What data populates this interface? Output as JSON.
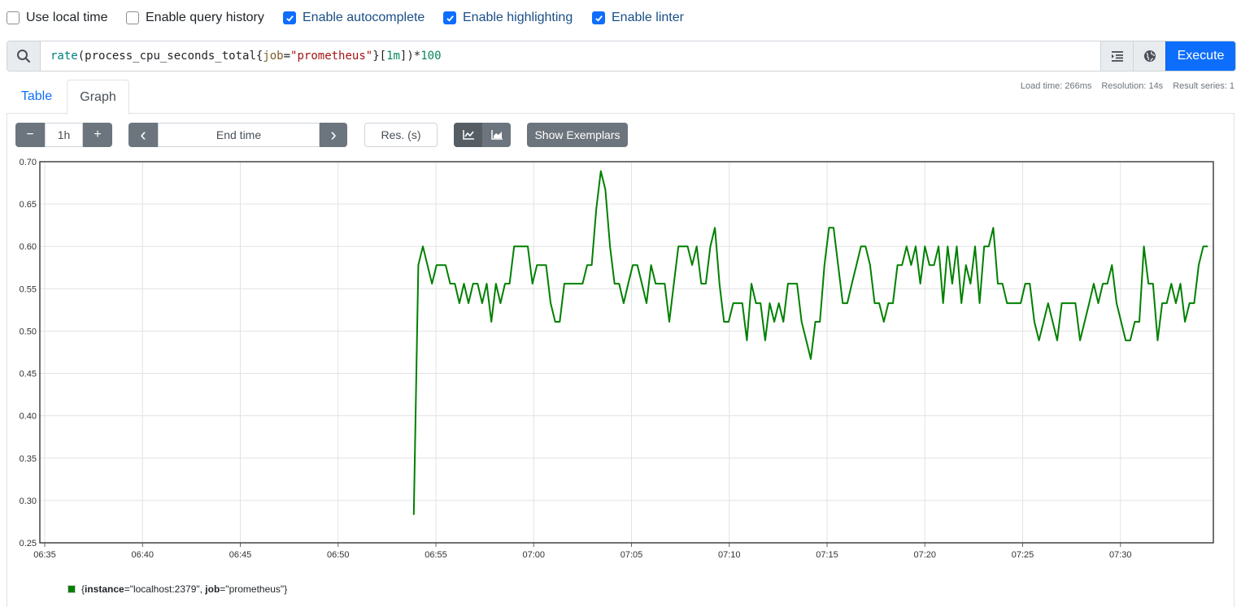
{
  "options": [
    {
      "label": "Use local time",
      "checked": false
    },
    {
      "label": "Enable query history",
      "checked": false
    },
    {
      "label": "Enable autocomplete",
      "checked": true
    },
    {
      "label": "Enable highlighting",
      "checked": true
    },
    {
      "label": "Enable linter",
      "checked": true
    }
  ],
  "query": {
    "fn": "rate",
    "metric": "process_cpu_seconds_total",
    "label_name": "job",
    "label_value": "\"prometheus\"",
    "range": "1m",
    "multiplier": "100"
  },
  "execute_label": "Execute",
  "stats": {
    "load_time": "Load time: 266ms",
    "resolution": "Resolution: 14s",
    "result_series": "Result series: 1"
  },
  "tabs": {
    "table": "Table",
    "graph": "Graph"
  },
  "controls": {
    "range_value": "1h",
    "minus": "−",
    "plus": "+",
    "end_time_placeholder": "End time",
    "prev": "‹",
    "next": "›",
    "res_placeholder": "Res. (s)",
    "show_exemplars": "Show Exemplars"
  },
  "icons": {
    "search": "search-icon",
    "format": "format-expression-icon",
    "metrics_explorer": "globe-icon",
    "line_mode": "line-chart-icon",
    "stacked_mode": "area-chart-icon"
  },
  "colors": {
    "accent": "#0d6efd",
    "series": "#008000"
  },
  "legend": {
    "open": "{",
    "k1": "instance",
    "v1": "=\"localhost:2379\", ",
    "k2": "job",
    "v2": "=\"prometheus\"",
    "close": "}"
  },
  "chart_data": {
    "type": "line",
    "x_ticks": [
      "06:35",
      "06:40",
      "06:45",
      "06:50",
      "06:55",
      "07:00",
      "07:05",
      "07:10",
      "07:15",
      "07:20",
      "07:25",
      "07:30"
    ],
    "y_ticks": [
      "0.25",
      "0.30",
      "0.35",
      "0.40",
      "0.45",
      "0.50",
      "0.55",
      "0.60",
      "0.65",
      "0.70"
    ],
    "xlim": [
      "06:34:45",
      "07:34:45"
    ],
    "ylim": [
      0.25,
      0.7
    ],
    "grid": true,
    "series": [
      {
        "name": "{instance=\"localhost:2379\", job=\"prometheus\"}",
        "x": [
          "06:53:52",
          "06:54:06",
          "06:54:20",
          "06:54:34",
          "06:54:48",
          "06:55:02",
          "06:55:16",
          "06:55:30",
          "06:55:44",
          "06:55:58",
          "06:56:12",
          "06:56:26",
          "06:56:40",
          "06:56:54",
          "06:57:08",
          "06:57:22",
          "06:57:36",
          "06:57:50",
          "06:58:04",
          "06:58:18",
          "06:58:32",
          "06:58:46",
          "06:59:00",
          "06:59:14",
          "06:59:28",
          "06:59:42",
          "06:59:56",
          "07:00:10",
          "07:00:24",
          "07:00:38",
          "07:00:52",
          "07:01:06",
          "07:01:20",
          "07:01:34",
          "07:01:48",
          "07:02:02",
          "07:02:16",
          "07:02:30",
          "07:02:44",
          "07:02:58",
          "07:03:12",
          "07:03:26",
          "07:03:40",
          "07:03:54",
          "07:04:08",
          "07:04:22",
          "07:04:36",
          "07:04:50",
          "07:05:04",
          "07:05:18",
          "07:05:32",
          "07:05:46",
          "07:06:00",
          "07:06:14",
          "07:06:28",
          "07:06:42",
          "07:06:56",
          "07:07:10",
          "07:07:24",
          "07:07:38",
          "07:07:52",
          "07:08:06",
          "07:08:20",
          "07:08:34",
          "07:08:48",
          "07:09:02",
          "07:09:16",
          "07:09:30",
          "07:09:44",
          "07:09:58",
          "07:10:12",
          "07:10:26",
          "07:10:40",
          "07:10:54",
          "07:11:08",
          "07:11:22",
          "07:11:36",
          "07:11:50",
          "07:12:04",
          "07:12:18",
          "07:12:32",
          "07:12:46",
          "07:13:00",
          "07:13:14",
          "07:13:28",
          "07:13:42",
          "07:13:56",
          "07:14:10",
          "07:14:24",
          "07:14:38",
          "07:14:52",
          "07:15:06",
          "07:15:20",
          "07:15:34",
          "07:15:48",
          "07:16:02",
          "07:16:16",
          "07:16:30",
          "07:16:44",
          "07:16:58",
          "07:17:12",
          "07:17:26",
          "07:17:40",
          "07:17:54",
          "07:18:08",
          "07:18:22",
          "07:18:36",
          "07:18:50",
          "07:19:04",
          "07:19:18",
          "07:19:32",
          "07:19:46",
          "07:20:00",
          "07:20:14",
          "07:20:28",
          "07:20:42",
          "07:20:56",
          "07:21:10",
          "07:21:24",
          "07:21:38",
          "07:21:52",
          "07:22:06",
          "07:22:20",
          "07:22:34",
          "07:22:48",
          "07:23:02",
          "07:23:16",
          "07:23:30",
          "07:23:44",
          "07:23:58",
          "07:24:12",
          "07:24:26",
          "07:24:40",
          "07:24:54",
          "07:25:08",
          "07:25:22",
          "07:25:36",
          "07:25:50",
          "07:26:04",
          "07:26:18",
          "07:26:32",
          "07:26:46",
          "07:27:00",
          "07:27:14",
          "07:27:28",
          "07:27:42",
          "07:27:56",
          "07:28:10",
          "07:28:24",
          "07:28:38",
          "07:28:52",
          "07:29:06",
          "07:29:20",
          "07:29:34",
          "07:29:48",
          "07:30:02",
          "07:30:16",
          "07:30:30",
          "07:30:44",
          "07:30:58",
          "07:31:12",
          "07:31:26",
          "07:31:40",
          "07:31:54",
          "07:32:08",
          "07:32:22",
          "07:32:36",
          "07:32:50",
          "07:33:04",
          "07:33:18",
          "07:33:32",
          "07:33:46",
          "07:34:00",
          "07:34:14",
          "07:34:28"
        ],
        "values": [
          0.283,
          0.578,
          0.6,
          0.578,
          0.556,
          0.578,
          0.578,
          0.578,
          0.556,
          0.556,
          0.533,
          0.556,
          0.533,
          0.556,
          0.556,
          0.533,
          0.556,
          0.511,
          0.556,
          0.533,
          0.556,
          0.556,
          0.6,
          0.6,
          0.6,
          0.6,
          0.556,
          0.578,
          0.578,
          0.578,
          0.533,
          0.511,
          0.511,
          0.556,
          0.556,
          0.556,
          0.556,
          0.556,
          0.578,
          0.578,
          0.644,
          0.689,
          0.667,
          0.6,
          0.556,
          0.556,
          0.533,
          0.556,
          0.578,
          0.578,
          0.556,
          0.533,
          0.578,
          0.556,
          0.556,
          0.556,
          0.511,
          0.556,
          0.6,
          0.6,
          0.6,
          0.578,
          0.6,
          0.556,
          0.556,
          0.6,
          0.622,
          0.556,
          0.511,
          0.511,
          0.533,
          0.533,
          0.533,
          0.489,
          0.556,
          0.533,
          0.533,
          0.489,
          0.533,
          0.511,
          0.533,
          0.511,
          0.556,
          0.556,
          0.556,
          0.511,
          0.489,
          0.467,
          0.511,
          0.511,
          0.578,
          0.622,
          0.622,
          0.578,
          0.533,
          0.533,
          0.556,
          0.578,
          0.6,
          0.6,
          0.578,
          0.533,
          0.533,
          0.511,
          0.533,
          0.533,
          0.578,
          0.578,
          0.6,
          0.578,
          0.6,
          0.556,
          0.6,
          0.578,
          0.578,
          0.6,
          0.533,
          0.6,
          0.556,
          0.6,
          0.533,
          0.578,
          0.556,
          0.6,
          0.533,
          0.6,
          0.6,
          0.622,
          0.556,
          0.556,
          0.533,
          0.533,
          0.533,
          0.533,
          0.556,
          0.556,
          0.511,
          0.489,
          0.511,
          0.533,
          0.511,
          0.489,
          0.533,
          0.533,
          0.533,
          0.533,
          0.489,
          0.511,
          0.533,
          0.556,
          0.533,
          0.556,
          0.556,
          0.578,
          0.533,
          0.511,
          0.489,
          0.489,
          0.511,
          0.511,
          0.6,
          0.556,
          0.556,
          0.489,
          0.533,
          0.533,
          0.556,
          0.533,
          0.556,
          0.511,
          0.533,
          0.533,
          0.578,
          0.6,
          0.6
        ]
      }
    ]
  }
}
